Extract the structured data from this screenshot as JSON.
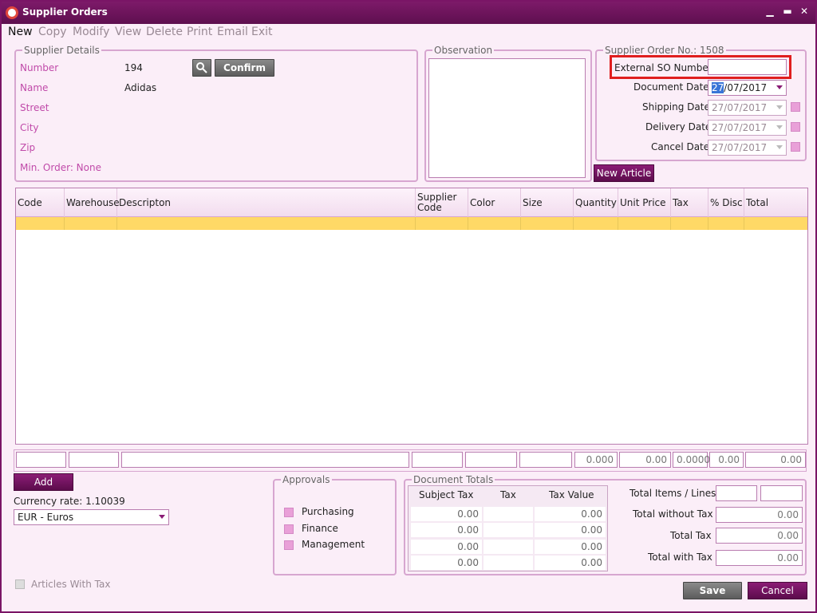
{
  "window": {
    "title": "Supplier Orders",
    "minimize": "▁",
    "maximize": "▬",
    "close": "✕"
  },
  "menu": [
    "New",
    "Copy",
    "Modify",
    "View",
    "Delete",
    "Print",
    "Email",
    "Exit"
  ],
  "supplier": {
    "legend": "Supplier Details",
    "number_label": "Number",
    "number": "194",
    "name_label": "Name",
    "name": "Adidas",
    "street_label": "Street",
    "city_label": "City",
    "zip_label": "Zip",
    "min_order": "Min. Order: None",
    "confirm": "Confirm"
  },
  "observation": {
    "legend": "Observation",
    "text": ""
  },
  "order": {
    "legend": "Supplier Order No.: 1508",
    "ext_label": "External SO Number",
    "ext_value": "",
    "doc_label": "Document Date",
    "doc_day": "27",
    "doc_rest": "/07/2017",
    "ship_label": "Shipping Date",
    "ship": "27/07/2017",
    "delivery_label": "Delivery Date",
    "delivery": "27/07/2017",
    "cancel_label": "Cancel Date",
    "cancel": "27/07/2017"
  },
  "new_article": "New Article",
  "grid": {
    "columns": [
      "Code",
      "Warehouse",
      "Descripton",
      "Supplier Code",
      "Color",
      "Size",
      "Quantity",
      "Unit Price",
      "Tax",
      "% Disc",
      "Total"
    ]
  },
  "subtotals": {
    "quantity": "0.000",
    "unit_price": "0.00",
    "tax": "0.0000",
    "disc": "0.00",
    "total": "0.00"
  },
  "add": "Add",
  "currency": {
    "rate_label": "Currency rate: 1.10039",
    "selected": "EUR - Euros"
  },
  "approvals": {
    "legend": "Approvals",
    "items": [
      "Purchasing",
      "Finance",
      "Management"
    ]
  },
  "doc_totals": {
    "legend": "Document Totals",
    "headers": [
      "Subject Tax",
      "Tax",
      "Tax Value"
    ],
    "rows": [
      [
        "0.00",
        "",
        "0.00"
      ],
      [
        "0.00",
        "",
        "0.00"
      ],
      [
        "0.00",
        "",
        "0.00"
      ],
      [
        "0.00",
        "",
        "0.00"
      ]
    ]
  },
  "totals": {
    "items_label": "Total Items / Lines",
    "without_tax_label": "Total without Tax",
    "without_tax": "0.00",
    "tax_label": "Total Tax",
    "tax": "0.00",
    "with_tax_label": "Total with Tax",
    "with_tax": "0.00"
  },
  "articles_with_tax": "Articles With Tax",
  "save": "Save",
  "cancel": "Cancel",
  "colors": {
    "accent": "#7a1566",
    "row_highlight": "#ffd966",
    "checkbox": "#e9a0d8",
    "focus_box": "#e01e1e"
  }
}
